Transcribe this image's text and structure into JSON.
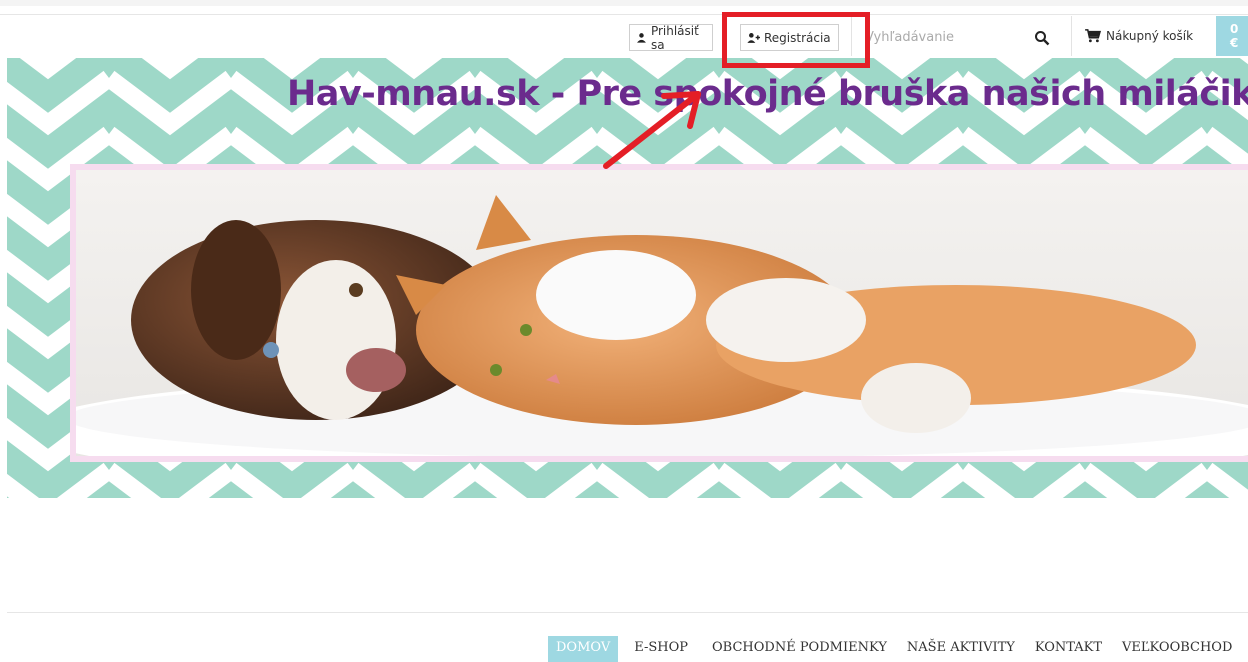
{
  "header": {
    "login_label": "Prihlásiť sa",
    "register_label": "Registrácia",
    "search_placeholder": "Vyhľadávanie",
    "cart_label": "Nákupný košík",
    "cart_total": "0 €",
    "icons": [
      "user-icon",
      "add-user-icon",
      "search-icon",
      "cart-icon"
    ]
  },
  "banner": {
    "tagline": "Hav-mnau.sk - Pre spokojné bruška našich miláčikov"
  },
  "nav": {
    "items": [
      "DOMOV",
      "E-SHOP",
      "OBCHODNÉ PODMIENKY",
      "NAŠE AKTIVITY",
      "KONTAKT",
      "VEĽKOOBCHOD"
    ],
    "active": "DOMOV"
  },
  "colors": {
    "accent": "#9ed8e2",
    "chevron": "#9ed8c8",
    "tagline": "#6b2b8d",
    "highlight": "#e41e26"
  }
}
